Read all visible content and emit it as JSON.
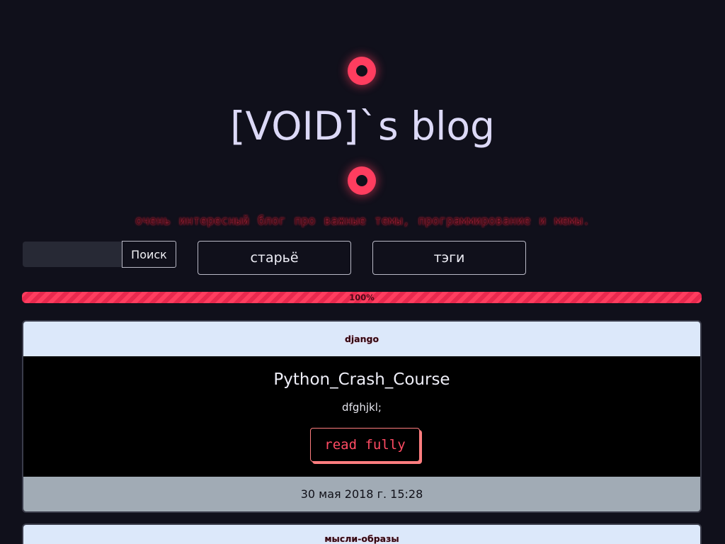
{
  "header": {
    "title": "[VOID]`s blog",
    "tagline": "очень интересный блог про важные темы, программирование и мемы."
  },
  "search": {
    "value": "",
    "placeholder": "",
    "button_label": "Поиск"
  },
  "nav": {
    "old_label": "старьё",
    "tags_label": "тэги"
  },
  "progress": {
    "label": "100%",
    "value": 100
  },
  "posts": [
    {
      "tag": "django",
      "title": "Python_Crash_Course",
      "excerpt": "dfghjkl;",
      "read_label": "read fully",
      "date": "30 мая 2018 г. 15:28"
    },
    {
      "tag": "мысли-образы"
    }
  ],
  "colors": {
    "background": "#10101b",
    "accent": "#ff3d5f",
    "card_header": "#dce8fa",
    "card_footer": "#a1abb5"
  },
  "icons": [
    "record-dot-icon",
    "record-dot-icon"
  ]
}
